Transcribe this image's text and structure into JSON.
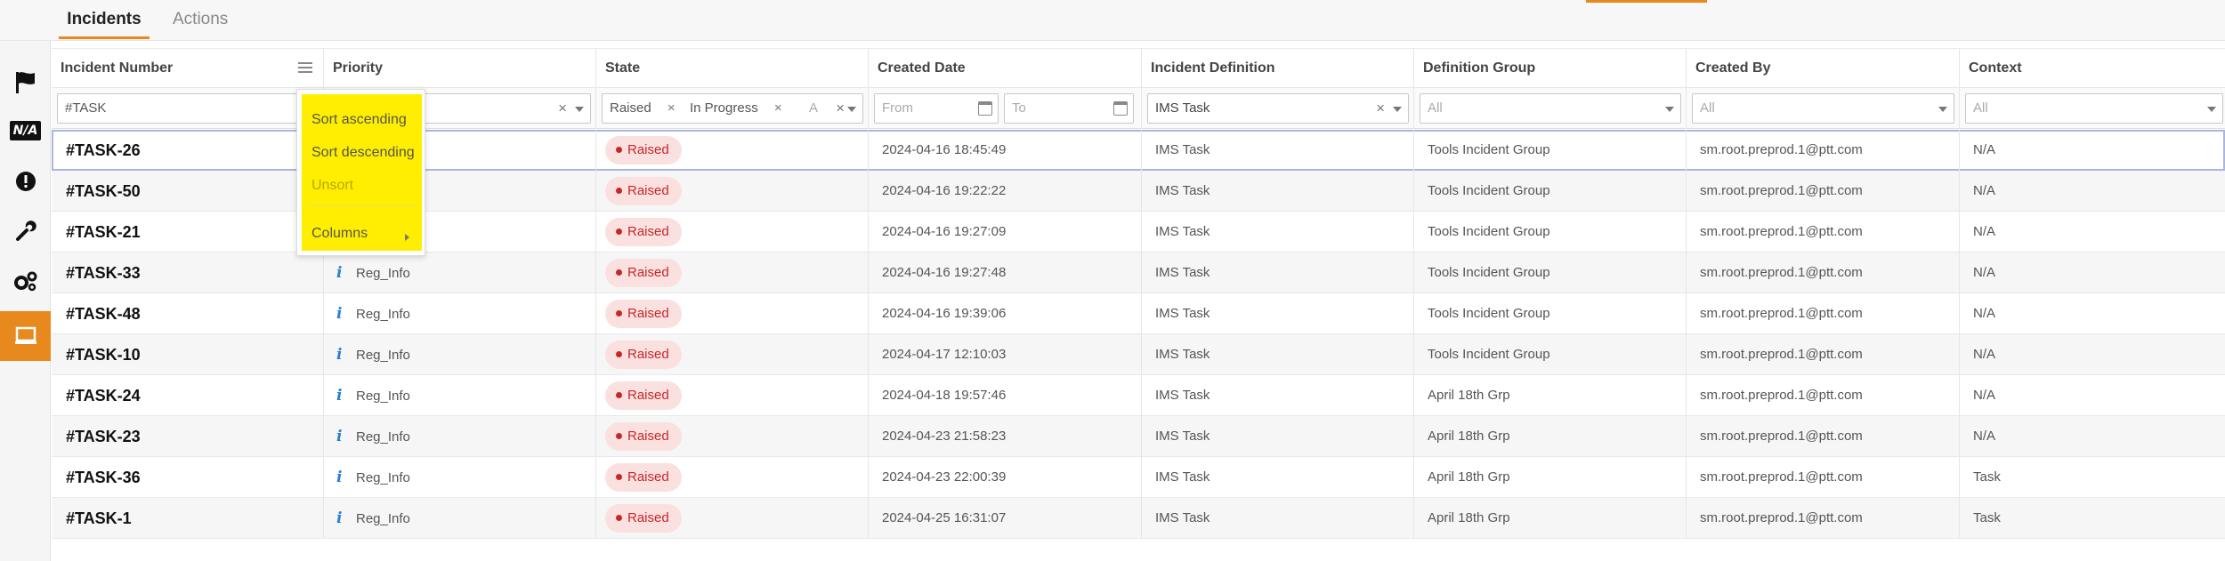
{
  "tabs": [
    {
      "label": "Incidents",
      "active": true
    },
    {
      "label": "Actions",
      "active": false
    }
  ],
  "sidebar": {
    "icons": [
      "flag-icon",
      "na-icon",
      "alert-icon",
      "wrench-icon",
      "gears-icon",
      "monitor-icon"
    ],
    "na_label": "N/A",
    "active_index": 5
  },
  "columns": [
    "Incident Number",
    "Priority",
    "State",
    "Created Date",
    "Incident Definition",
    "Definition Group",
    "Created By",
    "Context"
  ],
  "filters": {
    "incident_number": "#TASK",
    "state_chips": [
      "Raised",
      "In Progress",
      "A"
    ],
    "date_from_placeholder": "From",
    "date_to_placeholder": "To",
    "incident_definition": "IMS Task",
    "definition_group": "All",
    "created_by": "All",
    "context": "All"
  },
  "column_menu": {
    "items": [
      {
        "label": "Sort ascending",
        "disabled": false
      },
      {
        "label": "Sort descending",
        "disabled": false
      },
      {
        "label": "Unsort",
        "disabled": true
      },
      {
        "label": "Columns",
        "disabled": false
      }
    ]
  },
  "rows": [
    {
      "number": "#TASK-26",
      "priority": "",
      "state": "Raised",
      "created": "2024-04-16 18:45:49",
      "definition": "IMS Task",
      "group": "Tools Incident Group",
      "created_by": "sm.root.preprod.1@ptt.com",
      "context": "N/A"
    },
    {
      "number": "#TASK-50",
      "priority": "",
      "state": "Raised",
      "created": "2024-04-16 19:22:22",
      "definition": "IMS Task",
      "group": "Tools Incident Group",
      "created_by": "sm.root.preprod.1@ptt.com",
      "context": "N/A"
    },
    {
      "number": "#TASK-21",
      "priority": "",
      "state": "Raised",
      "created": "2024-04-16 19:27:09",
      "definition": "IMS Task",
      "group": "Tools Incident Group",
      "created_by": "sm.root.preprod.1@ptt.com",
      "context": "N/A"
    },
    {
      "number": "#TASK-33",
      "priority": "Reg_Info",
      "state": "Raised",
      "created": "2024-04-16 19:27:48",
      "definition": "IMS Task",
      "group": "Tools Incident Group",
      "created_by": "sm.root.preprod.1@ptt.com",
      "context": "N/A"
    },
    {
      "number": "#TASK-48",
      "priority": "Reg_Info",
      "state": "Raised",
      "created": "2024-04-16 19:39:06",
      "definition": "IMS Task",
      "group": "Tools Incident Group",
      "created_by": "sm.root.preprod.1@ptt.com",
      "context": "N/A"
    },
    {
      "number": "#TASK-10",
      "priority": "Reg_Info",
      "state": "Raised",
      "created": "2024-04-17 12:10:03",
      "definition": "IMS Task",
      "group": "Tools Incident Group",
      "created_by": "sm.root.preprod.1@ptt.com",
      "context": "N/A"
    },
    {
      "number": "#TASK-24",
      "priority": "Reg_Info",
      "state": "Raised",
      "created": "2024-04-18 19:57:46",
      "definition": "IMS Task",
      "group": "April 18th Grp",
      "created_by": "sm.root.preprod.1@ptt.com",
      "context": "N/A"
    },
    {
      "number": "#TASK-23",
      "priority": "Reg_Info",
      "state": "Raised",
      "created": "2024-04-23 21:58:23",
      "definition": "IMS Task",
      "group": "April 18th Grp",
      "created_by": "sm.root.preprod.1@ptt.com",
      "context": "N/A"
    },
    {
      "number": "#TASK-36",
      "priority": "Reg_Info",
      "state": "Raised",
      "created": "2024-04-23 22:00:39",
      "definition": "IMS Task",
      "group": "April 18th Grp",
      "created_by": "sm.root.preprod.1@ptt.com",
      "context": "Task"
    },
    {
      "number": "#TASK-1",
      "priority": "Reg_Info",
      "state": "Raised",
      "created": "2024-04-25 16:31:07",
      "definition": "IMS Task",
      "group": "April 18th Grp",
      "created_by": "sm.root.preprod.1@ptt.com",
      "context": "Task"
    }
  ],
  "colors": {
    "accent": "#e8891d",
    "raised_bg": "#fbe0e0",
    "raised_text": "#c62828",
    "info_icon": "#2a7fd4",
    "menu_highlight": "#ffee00"
  }
}
